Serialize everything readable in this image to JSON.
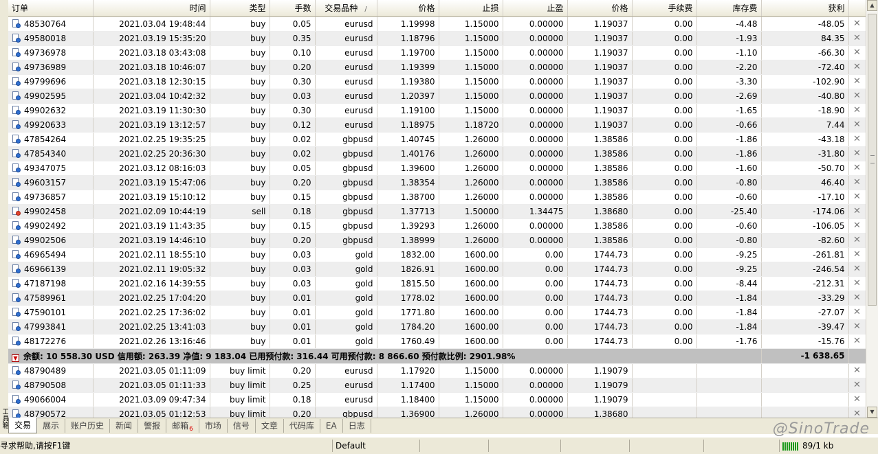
{
  "columns": {
    "order": "订单",
    "time": "时间",
    "type": "类型",
    "lots": "手数",
    "symbol": "交易品种",
    "price": "价格",
    "sl": "止损",
    "tp": "止盈",
    "cur_price": "价格",
    "commission": "手续费",
    "swap": "库存费",
    "profit": "获利"
  },
  "symbol_sort_mark": "/",
  "close_icon": "✕",
  "open_orders": [
    {
      "order": "48530764",
      "time": "2021.03.04 19:48:44",
      "type": "buy",
      "lots": "0.05",
      "symbol": "eurusd",
      "price": "1.19998",
      "sl": "1.15000",
      "tp": "0.00000",
      "cur": "1.19037",
      "commission": "0.00",
      "swap": "-4.48",
      "profit": "-48.05"
    },
    {
      "order": "49580018",
      "time": "2021.03.19 15:35:20",
      "type": "buy",
      "lots": "0.35",
      "symbol": "eurusd",
      "price": "1.18796",
      "sl": "1.15000",
      "tp": "0.00000",
      "cur": "1.19037",
      "commission": "0.00",
      "swap": "-1.93",
      "profit": "84.35"
    },
    {
      "order": "49736978",
      "time": "2021.03.18 03:43:08",
      "type": "buy",
      "lots": "0.10",
      "symbol": "eurusd",
      "price": "1.19700",
      "sl": "1.15000",
      "tp": "0.00000",
      "cur": "1.19037",
      "commission": "0.00",
      "swap": "-1.10",
      "profit": "-66.30"
    },
    {
      "order": "49736989",
      "time": "2021.03.18 10:46:07",
      "type": "buy",
      "lots": "0.20",
      "symbol": "eurusd",
      "price": "1.19399",
      "sl": "1.15000",
      "tp": "0.00000",
      "cur": "1.19037",
      "commission": "0.00",
      "swap": "-2.20",
      "profit": "-72.40"
    },
    {
      "order": "49799696",
      "time": "2021.03.18 12:30:15",
      "type": "buy",
      "lots": "0.30",
      "symbol": "eurusd",
      "price": "1.19380",
      "sl": "1.15000",
      "tp": "0.00000",
      "cur": "1.19037",
      "commission": "0.00",
      "swap": "-3.30",
      "profit": "-102.90"
    },
    {
      "order": "49902595",
      "time": "2021.03.04 10:42:32",
      "type": "buy",
      "lots": "0.03",
      "symbol": "eurusd",
      "price": "1.20397",
      "sl": "1.15000",
      "tp": "0.00000",
      "cur": "1.19037",
      "commission": "0.00",
      "swap": "-2.69",
      "profit": "-40.80"
    },
    {
      "order": "49902632",
      "time": "2021.03.19 11:30:30",
      "type": "buy",
      "lots": "0.30",
      "symbol": "eurusd",
      "price": "1.19100",
      "sl": "1.15000",
      "tp": "0.00000",
      "cur": "1.19037",
      "commission": "0.00",
      "swap": "-1.65",
      "profit": "-18.90"
    },
    {
      "order": "49920633",
      "time": "2021.03.19 13:12:57",
      "type": "buy",
      "lots": "0.12",
      "symbol": "eurusd",
      "price": "1.18975",
      "sl": "1.18720",
      "tp": "0.00000",
      "cur": "1.19037",
      "commission": "0.00",
      "swap": "-0.66",
      "profit": "7.44"
    },
    {
      "order": "47854264",
      "time": "2021.02.25 19:35:25",
      "type": "buy",
      "lots": "0.02",
      "symbol": "gbpusd",
      "price": "1.40745",
      "sl": "1.26000",
      "tp": "0.00000",
      "cur": "1.38586",
      "commission": "0.00",
      "swap": "-1.86",
      "profit": "-43.18"
    },
    {
      "order": "47854340",
      "time": "2021.02.25 20:36:30",
      "type": "buy",
      "lots": "0.02",
      "symbol": "gbpusd",
      "price": "1.40176",
      "sl": "1.26000",
      "tp": "0.00000",
      "cur": "1.38586",
      "commission": "0.00",
      "swap": "-1.86",
      "profit": "-31.80"
    },
    {
      "order": "49347075",
      "time": "2021.03.12 08:16:03",
      "type": "buy",
      "lots": "0.05",
      "symbol": "gbpusd",
      "price": "1.39600",
      "sl": "1.26000",
      "tp": "0.00000",
      "cur": "1.38586",
      "commission": "0.00",
      "swap": "-1.60",
      "profit": "-50.70"
    },
    {
      "order": "49603157",
      "time": "2021.03.19 15:47:06",
      "type": "buy",
      "lots": "0.20",
      "symbol": "gbpusd",
      "price": "1.38354",
      "sl": "1.26000",
      "tp": "0.00000",
      "cur": "1.38586",
      "commission": "0.00",
      "swap": "-0.80",
      "profit": "46.40"
    },
    {
      "order": "49736857",
      "time": "2021.03.19 15:10:12",
      "type": "buy",
      "lots": "0.15",
      "symbol": "gbpusd",
      "price": "1.38700",
      "sl": "1.26000",
      "tp": "0.00000",
      "cur": "1.38586",
      "commission": "0.00",
      "swap": "-0.60",
      "profit": "-17.10"
    },
    {
      "order": "49902458",
      "time": "2021.02.09 10:44:19",
      "type": "sell",
      "lots": "0.18",
      "symbol": "gbpusd",
      "price": "1.37713",
      "sl": "1.50000",
      "tp": "1.34475",
      "cur": "1.38680",
      "commission": "0.00",
      "swap": "-25.40",
      "profit": "-174.06"
    },
    {
      "order": "49902492",
      "time": "2021.03.19 11:43:35",
      "type": "buy",
      "lots": "0.15",
      "symbol": "gbpusd",
      "price": "1.39293",
      "sl": "1.26000",
      "tp": "0.00000",
      "cur": "1.38586",
      "commission": "0.00",
      "swap": "-0.60",
      "profit": "-106.05"
    },
    {
      "order": "49902506",
      "time": "2021.03.19 14:46:10",
      "type": "buy",
      "lots": "0.20",
      "symbol": "gbpusd",
      "price": "1.38999",
      "sl": "1.26000",
      "tp": "0.00000",
      "cur": "1.38586",
      "commission": "0.00",
      "swap": "-0.80",
      "profit": "-82.60"
    },
    {
      "order": "46965494",
      "time": "2021.02.11 18:55:10",
      "type": "buy",
      "lots": "0.03",
      "symbol": "gold",
      "price": "1832.00",
      "sl": "1600.00",
      "tp": "0.00",
      "cur": "1744.73",
      "commission": "0.00",
      "swap": "-9.25",
      "profit": "-261.81"
    },
    {
      "order": "46966139",
      "time": "2021.02.11 19:05:32",
      "type": "buy",
      "lots": "0.03",
      "symbol": "gold",
      "price": "1826.91",
      "sl": "1600.00",
      "tp": "0.00",
      "cur": "1744.73",
      "commission": "0.00",
      "swap": "-9.25",
      "profit": "-246.54"
    },
    {
      "order": "47187198",
      "time": "2021.02.16 14:39:55",
      "type": "buy",
      "lots": "0.03",
      "symbol": "gold",
      "price": "1815.50",
      "sl": "1600.00",
      "tp": "0.00",
      "cur": "1744.73",
      "commission": "0.00",
      "swap": "-8.44",
      "profit": "-212.31"
    },
    {
      "order": "47589961",
      "time": "2021.02.25 17:04:20",
      "type": "buy",
      "lots": "0.01",
      "symbol": "gold",
      "price": "1778.02",
      "sl": "1600.00",
      "tp": "0.00",
      "cur": "1744.73",
      "commission": "0.00",
      "swap": "-1.84",
      "profit": "-33.29"
    },
    {
      "order": "47590101",
      "time": "2021.02.25 17:36:02",
      "type": "buy",
      "lots": "0.01",
      "symbol": "gold",
      "price": "1771.80",
      "sl": "1600.00",
      "tp": "0.00",
      "cur": "1744.73",
      "commission": "0.00",
      "swap": "-1.84",
      "profit": "-27.07"
    },
    {
      "order": "47993841",
      "time": "2021.02.25 13:41:03",
      "type": "buy",
      "lots": "0.01",
      "symbol": "gold",
      "price": "1784.20",
      "sl": "1600.00",
      "tp": "0.00",
      "cur": "1744.73",
      "commission": "0.00",
      "swap": "-1.84",
      "profit": "-39.47"
    },
    {
      "order": "48172276",
      "time": "2021.02.26 13:16:46",
      "type": "buy",
      "lots": "0.01",
      "symbol": "gold",
      "price": "1760.49",
      "sl": "1600.00",
      "tp": "0.00",
      "cur": "1744.73",
      "commission": "0.00",
      "swap": "-1.76",
      "profit": "-15.76"
    }
  ],
  "summary": {
    "text": "余额: 10 558.30 USD  信用额: 263.39  净值: 9 183.04  已用预付款: 316.44  可用预付款: 8 866.60  预付款比例: 2901.98%",
    "total_profit": "-1 638.65"
  },
  "pending_orders": [
    {
      "order": "48790489",
      "time": "2021.03.05 01:11:09",
      "type": "buy limit",
      "lots": "0.20",
      "symbol": "eurusd",
      "price": "1.17920",
      "sl": "1.15000",
      "tp": "0.00000",
      "cur": "1.19079"
    },
    {
      "order": "48790508",
      "time": "2021.03.05 01:11:33",
      "type": "buy limit",
      "lots": "0.25",
      "symbol": "eurusd",
      "price": "1.17400",
      "sl": "1.15000",
      "tp": "0.00000",
      "cur": "1.19079"
    },
    {
      "order": "49066004",
      "time": "2021.03.09 09:47:34",
      "type": "buy limit",
      "lots": "0.18",
      "symbol": "eurusd",
      "price": "1.18400",
      "sl": "1.15000",
      "tp": "0.00000",
      "cur": "1.19079"
    },
    {
      "order": "48790572",
      "time": "2021.03.05 01:12:53",
      "type": "buy limit",
      "lots": "0.20",
      "symbol": "gbpusd",
      "price": "1.36900",
      "sl": "1.26000",
      "tp": "0.00000",
      "cur": "1.38680"
    }
  ],
  "tabs": [
    {
      "label": "交易",
      "active": true
    },
    {
      "label": "展示"
    },
    {
      "label": "账户历史"
    },
    {
      "label": "新闻"
    },
    {
      "label": "警报"
    },
    {
      "label": "邮箱",
      "badge": "6"
    },
    {
      "label": "市场"
    },
    {
      "label": "信号"
    },
    {
      "label": "文章"
    },
    {
      "label": "代码库"
    },
    {
      "label": "EA"
    },
    {
      "label": "日志"
    }
  ],
  "side_label": "工具箱",
  "watermark": "@SinoTrade",
  "status": {
    "help": "寻求帮助,请按F1键",
    "profile": "Default",
    "traffic": "89/1 kb"
  },
  "colors": {
    "buy_icon": "#2f6fd0",
    "sell_icon": "#e0432c",
    "summary_bg": "#c0c0c0"
  },
  "icons": {
    "order_icon": "order-document-icon",
    "close_icon": "close-icon",
    "scroll_up": "arrow-up-icon",
    "scroll_down": "arrow-down-icon"
  }
}
